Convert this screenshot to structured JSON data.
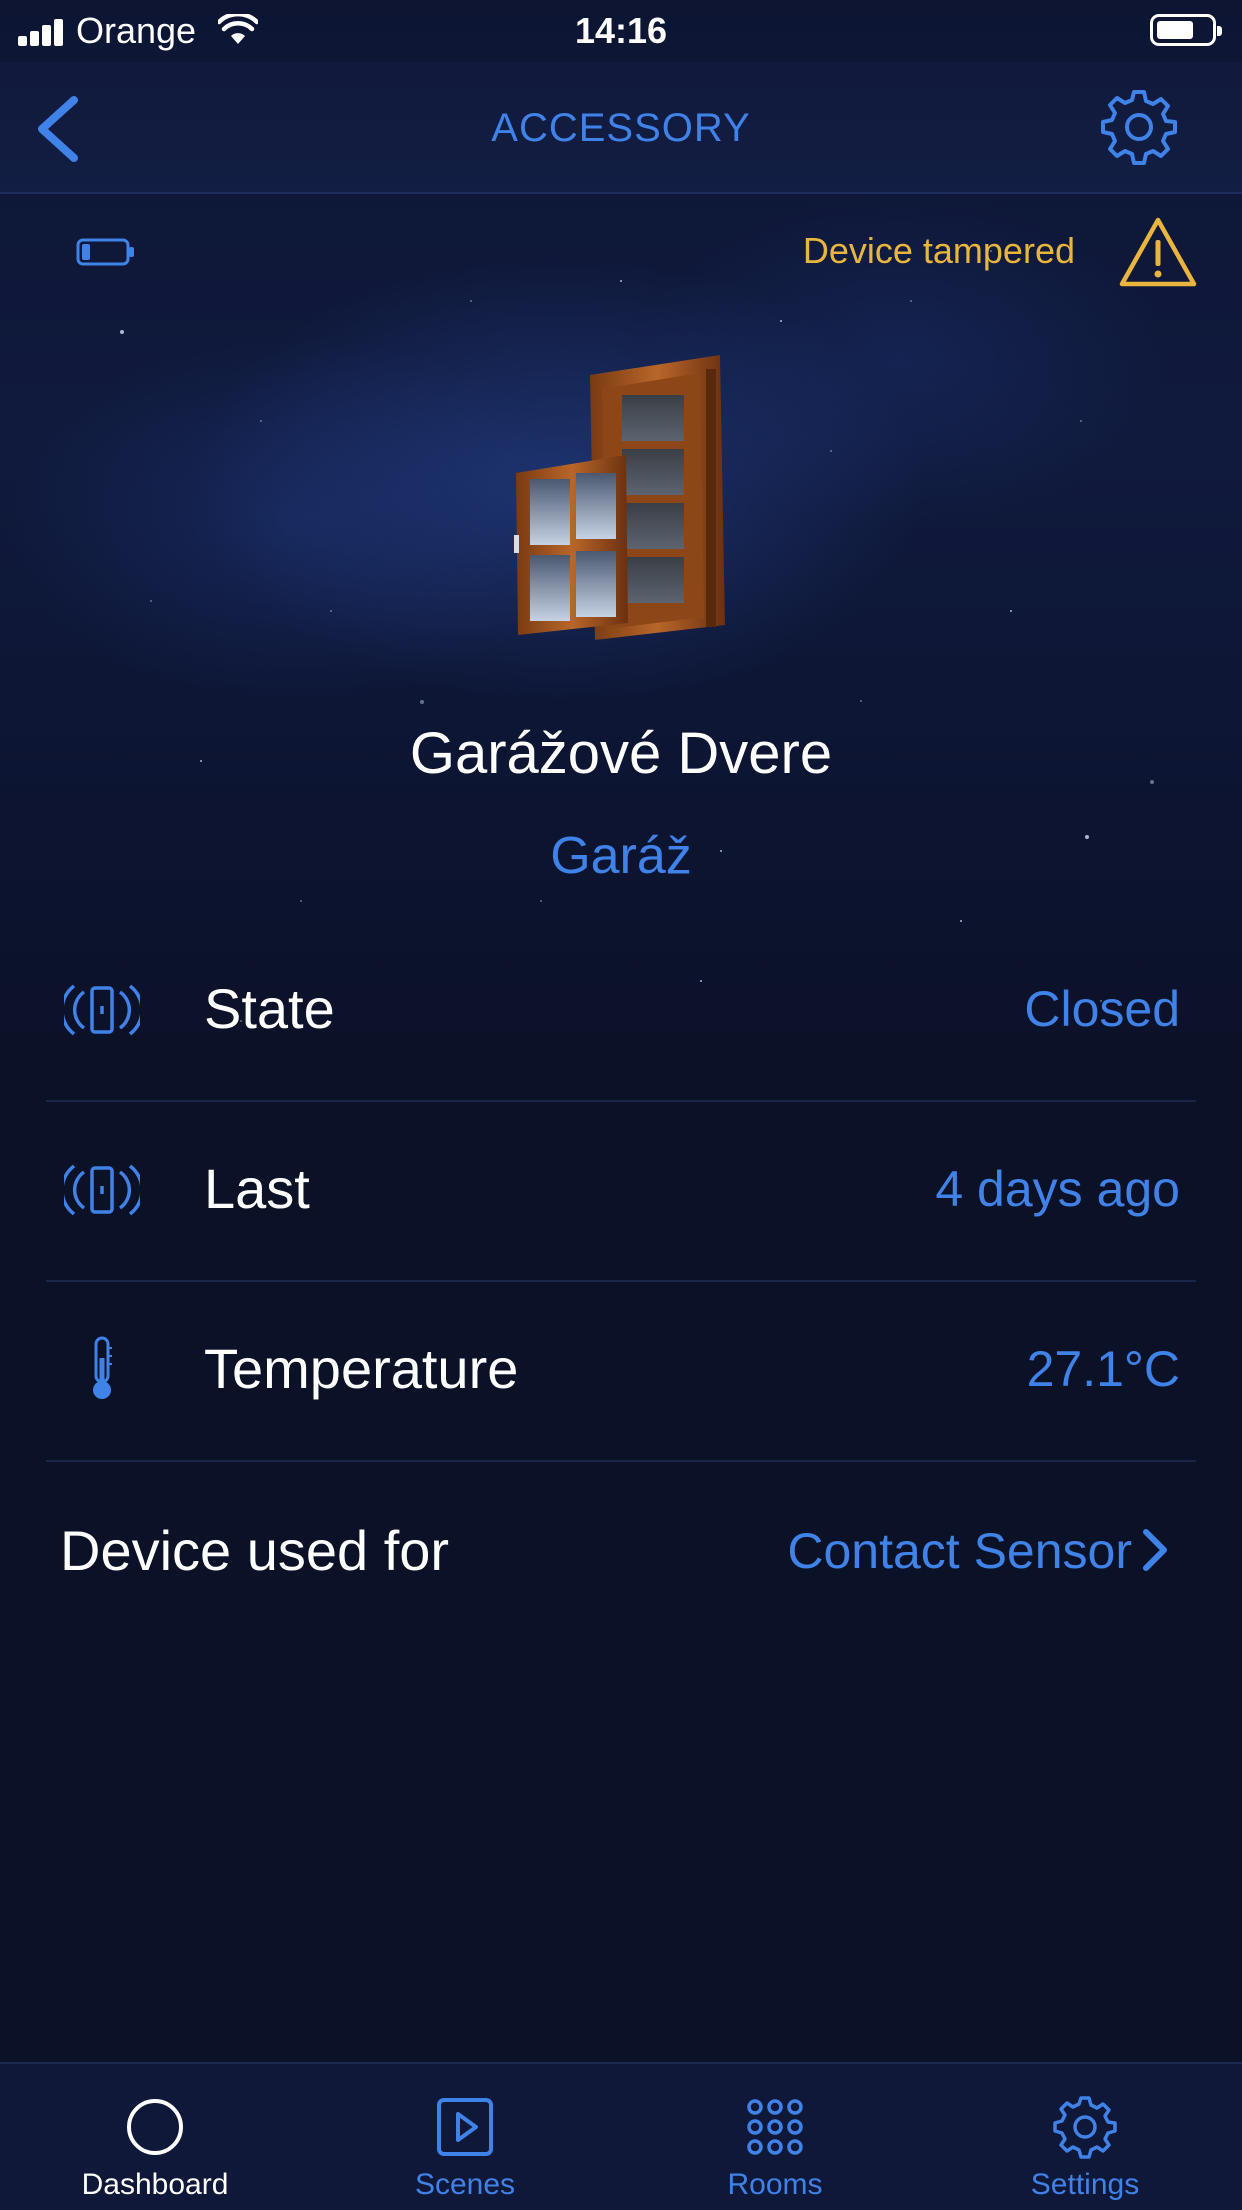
{
  "status_bar": {
    "carrier": "Orange",
    "time": "14:16"
  },
  "nav": {
    "title": "ACCESSORY",
    "back_icon": "chevron-left-icon",
    "settings_icon": "gear-icon"
  },
  "device": {
    "tamper_warning": "Device tampered",
    "name": "Garážové Dvere",
    "room": "Garáž",
    "image_icon": "door-window-icon",
    "battery_level": 0.2
  },
  "rows": [
    {
      "label": "State",
      "value": "Closed",
      "icon": "contact-sensor-icon"
    },
    {
      "label": "Last",
      "value": "4 days ago",
      "icon": "contact-sensor-icon"
    },
    {
      "label": "Temperature",
      "value": "27.1°C",
      "icon": "thermometer-icon"
    }
  ],
  "usage": {
    "label": "Device used for",
    "value": "Contact Sensor"
  },
  "tabs": [
    {
      "label": "Dashboard",
      "icon": "circle-icon",
      "active": true
    },
    {
      "label": "Scenes",
      "icon": "play-square-icon",
      "active": false
    },
    {
      "label": "Rooms",
      "icon": "grid-dots-icon",
      "active": false
    },
    {
      "label": "Settings",
      "icon": "gear-icon",
      "active": false
    }
  ],
  "colors": {
    "accent": "#3f82e8",
    "warning": "#e9b53c",
    "background": "#0b1126"
  }
}
